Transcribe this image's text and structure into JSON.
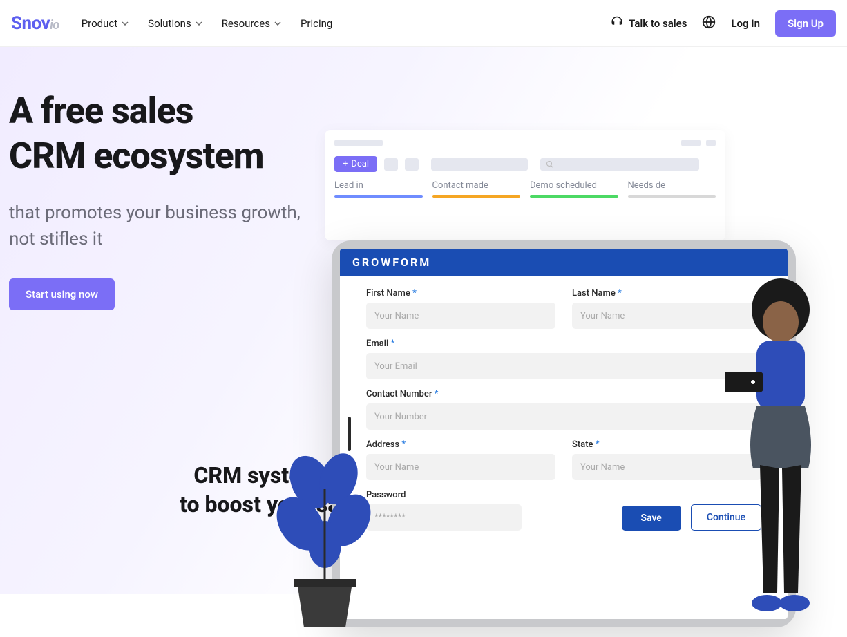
{
  "header": {
    "logo_main": "Snov",
    "logo_suffix": "io",
    "nav": [
      {
        "label": "Product",
        "has_dropdown": true
      },
      {
        "label": "Solutions",
        "has_dropdown": true
      },
      {
        "label": "Resources",
        "has_dropdown": true
      },
      {
        "label": "Pricing",
        "has_dropdown": false
      }
    ],
    "talk_to_sales": "Talk to sales",
    "login": "Log In",
    "signup": "Sign Up"
  },
  "hero": {
    "title_line1": "A free sales",
    "title_line2": "CRM ecosystem",
    "subtitle_line1": "that promotes your business growth,",
    "subtitle_line2": "not stifles it",
    "cta": "Start using now",
    "secondary_line1": "CRM systems",
    "secondary_line2": "to boost your sal"
  },
  "crm_preview": {
    "deal_button": "Deal",
    "columns": [
      "Lead in",
      "Contact made",
      "Demo scheduled",
      "Needs de"
    ],
    "column_colors": [
      "#6f8cff",
      "#f5a623",
      "#4cd964",
      "#d8d8d8"
    ]
  },
  "form": {
    "title": "GROWFORM",
    "fields": {
      "first_name": {
        "label": "First Name",
        "placeholder": "Your Name",
        "required": true
      },
      "last_name": {
        "label": "Last Name",
        "placeholder": "Your Name",
        "required": true
      },
      "email": {
        "label": "Email",
        "placeholder": "Your Email",
        "required": true
      },
      "contact": {
        "label": "Contact Number",
        "placeholder": "Your Number",
        "required": true
      },
      "address": {
        "label": "Address",
        "placeholder": "Your Name",
        "required": true
      },
      "state": {
        "label": "State",
        "placeholder": "Your Name",
        "required": true
      },
      "password": {
        "label": "Password",
        "placeholder": "********",
        "required": false
      }
    },
    "save": "Save",
    "continue": "Continue"
  }
}
